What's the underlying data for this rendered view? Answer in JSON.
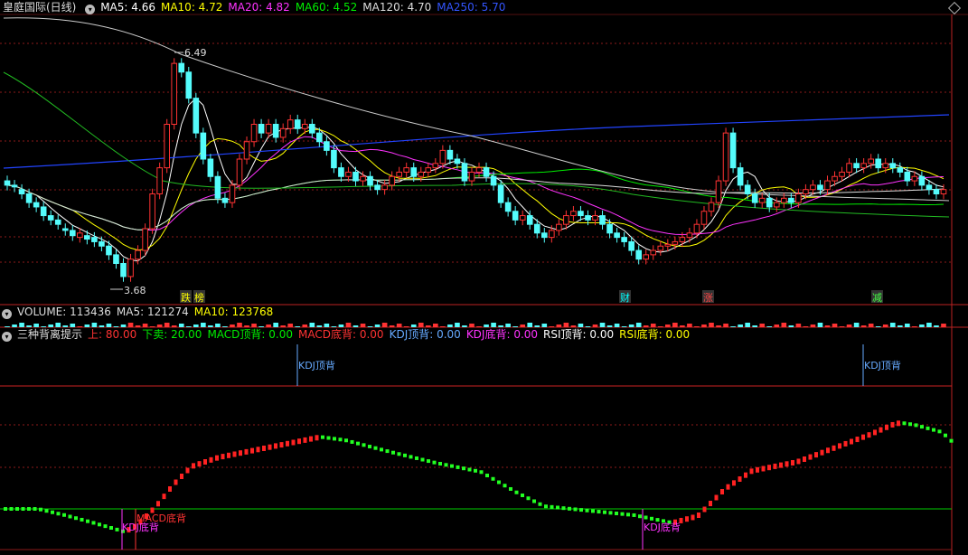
{
  "header": {
    "stock_name": "皇庭国际(日线)",
    "ma_items": [
      {
        "text": "MA5: 4.66",
        "color": "#ffffff"
      },
      {
        "text": "MA10: 4.72",
        "color": "#ffff00"
      },
      {
        "text": "MA20: 4.82",
        "color": "#ff33ff"
      },
      {
        "text": "MA60: 4.52",
        "color": "#00ee00"
      },
      {
        "text": "MA120: 4.70",
        "color": "#dddddd"
      },
      {
        "text": "MA250: 5.70",
        "color": "#3355ff"
      }
    ]
  },
  "price_pane": {
    "high_label": "6.49",
    "low_label": "3.68",
    "events": [
      {
        "text": "跌",
        "color": "#ffff00"
      },
      {
        "text": "榜",
        "color": "#ffff00"
      },
      {
        "text": "财",
        "color": "#00ffff"
      },
      {
        "text": "涨",
        "color": "#ff4444"
      },
      {
        "text": "减",
        "color": "#44ff44"
      }
    ]
  },
  "volume_bar": {
    "title": "VOLUME: 113436",
    "ma5": "MA5: 121274",
    "ma10": "MA10: 123768"
  },
  "indicator": {
    "title": "三种背离提示",
    "params": [
      {
        "text": "上: 80.00",
        "color": "#ff3333"
      },
      {
        "text": "下卖: 20.00",
        "color": "#00ee00"
      },
      {
        "text": "MACD顶背: 0.00",
        "color": "#00ee00"
      },
      {
        "text": "MACD底背: 0.00",
        "color": "#ff3333"
      },
      {
        "text": "KDJ顶背: 0.00",
        "color": "#66aaff"
      },
      {
        "text": "KDJ底背: 0.00",
        "color": "#ff33ff"
      },
      {
        "text": "RSI顶背: 0.00",
        "color": "#ffffff"
      },
      {
        "text": "RSI底背: 0.00",
        "color": "#ffff00"
      }
    ],
    "signals": [
      {
        "text": "KDJ顶背",
        "color": "#66aaff"
      },
      {
        "text": "KDJ顶背",
        "color": "#66aaff"
      },
      {
        "text": "KDJ底背",
        "color": "#ff33ff"
      },
      {
        "text": "MACD底背",
        "color": "#ff3333"
      },
      {
        "text": "KDJ底背",
        "color": "#ff33ff"
      }
    ]
  },
  "chart_data": {
    "type": "candlestick",
    "bar_count": 145,
    "price_range": [
      3.5,
      6.7
    ],
    "candles_open_close": [
      [
        4.85,
        4.8
      ],
      [
        4.8,
        4.78
      ],
      [
        4.75,
        4.7
      ],
      [
        4.7,
        4.6
      ],
      [
        4.6,
        4.55
      ],
      [
        4.55,
        4.45
      ],
      [
        4.45,
        4.4
      ],
      [
        4.4,
        4.35
      ],
      [
        4.3,
        4.28
      ],
      [
        4.28,
        4.22
      ],
      [
        4.2,
        4.25
      ],
      [
        4.22,
        4.18
      ],
      [
        4.2,
        4.15
      ],
      [
        4.15,
        4.1
      ],
      [
        4.1,
        4.0
      ],
      [
        4.0,
        3.9
      ],
      [
        3.9,
        3.75
      ],
      [
        3.75,
        3.95
      ],
      [
        3.95,
        4.05
      ],
      [
        4.05,
        4.3
      ],
      [
        4.3,
        4.7
      ],
      [
        4.7,
        5.0
      ],
      [
        5.0,
        5.5
      ],
      [
        5.5,
        6.2
      ],
      [
        6.2,
        6.1
      ],
      [
        6.1,
        5.8
      ],
      [
        5.8,
        5.4
      ],
      [
        5.4,
        5.1
      ],
      [
        5.1,
        4.9
      ],
      [
        4.9,
        4.65
      ],
      [
        4.65,
        4.6
      ],
      [
        4.6,
        4.8
      ],
      [
        4.8,
        5.1
      ],
      [
        5.1,
        5.3
      ],
      [
        5.3,
        5.5
      ],
      [
        5.5,
        5.4
      ],
      [
        5.4,
        5.5
      ],
      [
        5.5,
        5.35
      ],
      [
        5.35,
        5.45
      ],
      [
        5.45,
        5.55
      ],
      [
        5.55,
        5.45
      ],
      [
        5.45,
        5.5
      ],
      [
        5.5,
        5.4
      ],
      [
        5.4,
        5.3
      ],
      [
        5.3,
        5.2
      ],
      [
        5.2,
        5.0
      ],
      [
        5.0,
        4.9
      ],
      [
        4.9,
        4.95
      ],
      [
        4.95,
        4.85
      ],
      [
        4.85,
        4.9
      ],
      [
        4.9,
        4.8
      ],
      [
        4.8,
        4.75
      ],
      [
        4.75,
        4.8
      ],
      [
        4.8,
        4.9
      ],
      [
        4.9,
        4.95
      ],
      [
        4.95,
        5.0
      ],
      [
        5.0,
        4.9
      ],
      [
        4.9,
        4.95
      ],
      [
        4.95,
        5.0
      ],
      [
        5.0,
        5.05
      ],
      [
        5.05,
        5.2
      ],
      [
        5.2,
        5.1
      ],
      [
        5.1,
        5.05
      ],
      [
        5.05,
        4.85
      ],
      [
        4.85,
        4.95
      ],
      [
        4.95,
        5.0
      ],
      [
        5.0,
        4.9
      ],
      [
        4.9,
        4.8
      ],
      [
        4.8,
        4.6
      ],
      [
        4.6,
        4.5
      ],
      [
        4.5,
        4.4
      ],
      [
        4.4,
        4.45
      ],
      [
        4.45,
        4.35
      ],
      [
        4.35,
        4.25
      ],
      [
        4.25,
        4.2
      ],
      [
        4.2,
        4.28
      ],
      [
        4.28,
        4.35
      ],
      [
        4.35,
        4.45
      ],
      [
        4.45,
        4.5
      ],
      [
        4.5,
        4.45
      ],
      [
        4.45,
        4.4
      ],
      [
        4.4,
        4.45
      ],
      [
        4.45,
        4.35
      ],
      [
        4.35,
        4.25
      ],
      [
        4.25,
        4.2
      ],
      [
        4.2,
        4.15
      ],
      [
        4.15,
        4.05
      ],
      [
        4.05,
        3.95
      ],
      [
        3.95,
        4.0
      ],
      [
        4.0,
        4.05
      ],
      [
        4.05,
        4.1
      ],
      [
        4.1,
        4.12
      ],
      [
        4.12,
        4.15
      ],
      [
        4.15,
        4.2
      ],
      [
        4.2,
        4.25
      ],
      [
        4.25,
        4.35
      ],
      [
        4.35,
        4.5
      ],
      [
        4.5,
        4.6
      ],
      [
        4.6,
        4.85
      ],
      [
        4.85,
        5.4
      ],
      [
        5.4,
        5.0
      ],
      [
        5.0,
        4.8
      ],
      [
        4.8,
        4.7
      ],
      [
        4.7,
        4.6
      ],
      [
        4.6,
        4.65
      ],
      [
        4.65,
        4.55
      ],
      [
        4.55,
        4.6
      ],
      [
        4.6,
        4.65
      ],
      [
        4.65,
        4.6
      ],
      [
        4.6,
        4.7
      ],
      [
        4.7,
        4.75
      ],
      [
        4.75,
        4.8
      ],
      [
        4.8,
        4.75
      ],
      [
        4.75,
        4.85
      ],
      [
        4.85,
        4.9
      ],
      [
        4.9,
        4.95
      ],
      [
        4.95,
        5.05
      ],
      [
        5.05,
        5.0
      ],
      [
        5.0,
        5.05
      ],
      [
        5.05,
        5.1
      ],
      [
        5.1,
        5.0
      ],
      [
        5.0,
        5.05
      ],
      [
        5.05,
        5.0
      ],
      [
        5.0,
        4.95
      ],
      [
        4.95,
        4.85
      ],
      [
        4.85,
        4.9
      ],
      [
        4.9,
        4.8
      ],
      [
        4.8,
        4.75
      ],
      [
        4.75,
        4.7
      ],
      [
        4.7,
        4.75
      ]
    ]
  }
}
